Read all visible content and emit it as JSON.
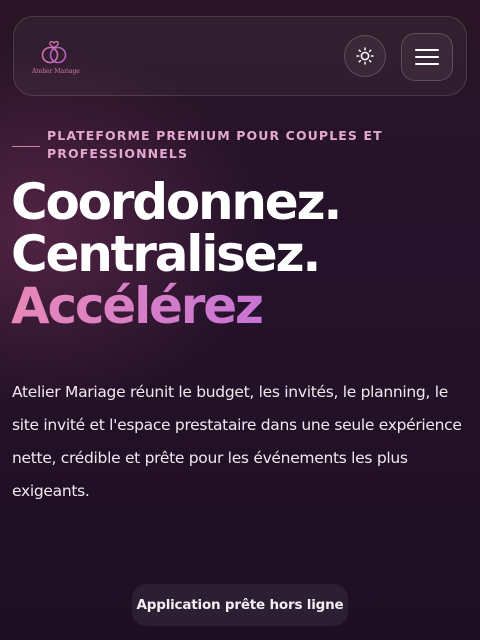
{
  "header": {
    "brand_name": "Atelier Mariage",
    "logo_icon": "interlocking-rings-icon",
    "theme_toggle_icon": "sun-icon",
    "menu_icon": "hamburger-menu-icon"
  },
  "hero": {
    "eyebrow": "PLATEFORME PREMIUM POUR COUPLES ET PROFESSIONNELS",
    "headline_lines": [
      "Coordonnez.",
      "Centralisez.",
      "Accélérez"
    ],
    "description": "Atelier Mariage réunit le budget, les invités, le planning, le site invité et l'espace prestataire dans une seule expérience nette, crédible et prête pour les événements les plus exigeants."
  },
  "toast": {
    "message": "Application prête hors ligne"
  },
  "colors": {
    "accent_pink": "#e888b8",
    "accent_purple": "#a96ad8",
    "eyebrow": "#e3a8d2",
    "background": "#24122a"
  }
}
